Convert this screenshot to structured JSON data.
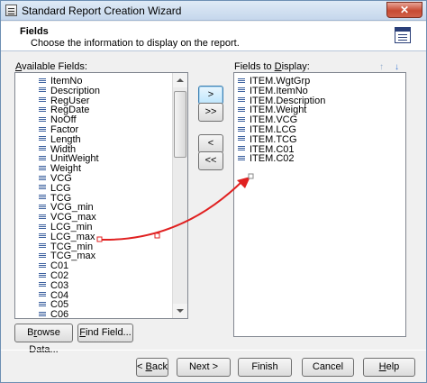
{
  "window": {
    "title": "Standard Report Creation Wizard",
    "close_label": "✕"
  },
  "header": {
    "title": "Fields",
    "subtitle": "Choose the information to display on the report."
  },
  "available": {
    "label_access": "A",
    "label_rest": "vailable Fields:",
    "items": [
      "ItemNo",
      "Description",
      "RegUser",
      "RegDate",
      "NoOff",
      "Factor",
      "Length",
      "Width",
      "UnitWeight",
      "Weight",
      "VCG",
      "LCG",
      "TCG",
      "VCG_min",
      "VCG_max",
      "LCG_min",
      "LCG_max",
      "TCG_min",
      "TCG_max",
      "C01",
      "C02",
      "C03",
      "C04",
      "C05",
      "C06"
    ]
  },
  "display": {
    "label_pre": "Fields to ",
    "label_access": "D",
    "label_rest": "isplay:",
    "items": [
      "ITEM.WgtGrp",
      "ITEM.ItemNo",
      "ITEM.Description",
      "ITEM.Weight",
      "ITEM.VCG",
      "ITEM.LCG",
      "ITEM.TCG",
      "ITEM.C01",
      "ITEM.C02"
    ]
  },
  "transfer": {
    "add": ">",
    "add_all": ">>",
    "remove": "<",
    "remove_all": "<<"
  },
  "order": {
    "up": "↑",
    "down": "↓"
  },
  "buttons": {
    "browse_access": "r",
    "browse_pre": "B",
    "browse_rest": "owse Data...",
    "find_access": "F",
    "find_rest": "ind Field...",
    "back_pre": "< ",
    "back_access": "B",
    "back_rest": "ack",
    "next": "Next >",
    "finish": "Finish",
    "cancel": "Cancel",
    "help_access": "H",
    "help_rest": "elp"
  },
  "colors": {
    "annotation_arrow": "#e02020",
    "accent": "#3c7fb1"
  }
}
